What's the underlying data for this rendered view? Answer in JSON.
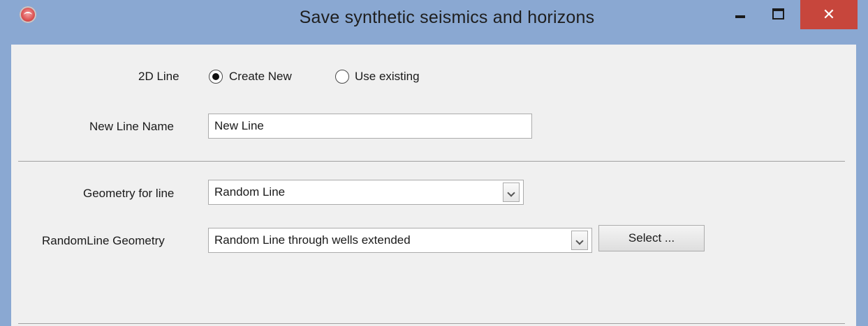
{
  "window": {
    "title": "Save synthetic seismics and horizons",
    "close_glyph": "✕"
  },
  "line_choice": {
    "label": "2D Line",
    "options": [
      {
        "label": "Create New",
        "selected": true
      },
      {
        "label": "Use existing",
        "selected": false
      }
    ]
  },
  "new_line_name": {
    "label": "New Line Name",
    "value": "New Line"
  },
  "geometry": {
    "label": "Geometry for line",
    "selected": "Random Line"
  },
  "random_line_geometry": {
    "label": "RandomLine Geometry",
    "selected": "Random Line through wells extended",
    "select_button": "Select ..."
  },
  "icons": {
    "app": "app-logo-icon",
    "minimize": "minimize-icon",
    "maximize": "maximize-icon",
    "close": "close-icon",
    "dropdown": "chevron-down-icon"
  },
  "colors": {
    "titlebar": "#8aa8d2",
    "close": "#c7463c",
    "panel": "#f0f0f0"
  }
}
